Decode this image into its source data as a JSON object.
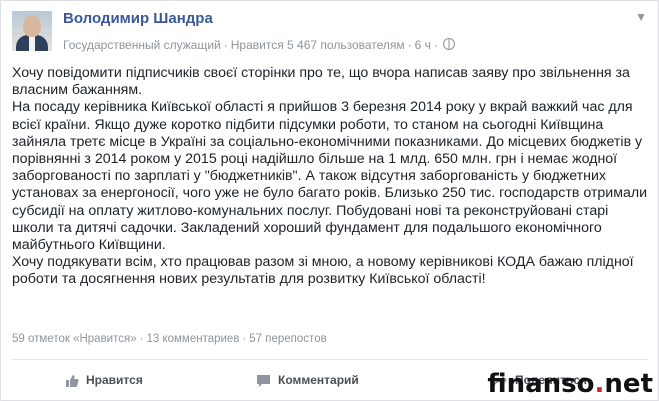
{
  "author": {
    "name": "Володимир Шандра",
    "role": "Государственный служащий",
    "likes": "Нравится 5 467 пользователям",
    "time": "6 ч"
  },
  "post": {
    "paragraphs": [
      "Хочу повідомити підписчиків своєї сторінки про те, що вчора написав заяву про звільнення за власним бажанням.",
      "На посаду керівника Київської області я прийшов 3 березня 2014 року у вкрай важкий час для всієї країни. Якщо дуже коротко підбити підсумки роботи, то станом на сьогодні Київщина зайняла третє місце в Україні за соціально-економічними показниками. До місцевих бюджетів у порівнянні з 2014 роком у 2015 році надійшло більше на 1 млд. 650 млн. грн і немає жодної заборгованості по зарплаті у \"бюджетників\". А також відсутня заборгованість у бюджетних установах за енергоносії, чого уже не було багато років. Близько 250 тис. господарств отримали субсидії на оплату житлово-комунальних послуг. Побудовані нові та реконструйовані старі школи та дитячі садочки. Закладений хороший фундамент для подальшого економічного майбутнього Київщини.",
      "Хочу подякувати всім, хто працював разом зі мною, а новому керівникові КОДА бажаю плідної роботи та досягнення нових результатів для розвитку Київської області!"
    ]
  },
  "stats": {
    "likes": "59 отметок «Нравится»",
    "comments": "13 комментариев",
    "shares": "57 перепостов"
  },
  "actions": {
    "like": "Нравится",
    "comment": "Комментарий",
    "share": "Поделиться"
  },
  "watermark": {
    "brand": "finanso",
    "dot": ".",
    "tld": "net"
  },
  "colors": {
    "link": "#3b5998",
    "meta": "#90949c",
    "text": "#1d2129",
    "watermark_dot": "#d8232a"
  },
  "icons": {
    "audience": "globe-icon",
    "menu": "chevron-down-icon",
    "like": "thumbs-up-icon",
    "comment": "speech-bubble-icon",
    "share": "share-arrow-icon"
  }
}
